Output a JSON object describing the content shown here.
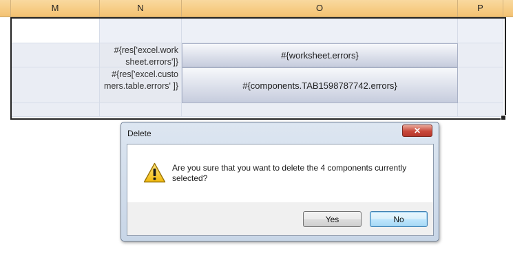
{
  "spreadsheet": {
    "columns": [
      "M",
      "N",
      "O",
      "P"
    ],
    "rows": [
      {
        "key_text": "",
        "value_text": ""
      },
      {
        "key_text": "#{res['excel.work sheet.errors']}",
        "value_text": "#{worksheet.errors}"
      },
      {
        "key_text": "#{res['excel.custo mers.table.errors' ]}",
        "value_text": "#{components.TAB1598787742.errors}"
      }
    ]
  },
  "dialog": {
    "title": "Delete",
    "close_label": "✕",
    "message": "Are you sure that you want to delete the 4 components currently selected?",
    "icon": "warning-icon",
    "buttons": {
      "yes": "Yes",
      "no": "No"
    }
  },
  "colors": {
    "header_bg": "#f4c271",
    "cell_bg": "#eaedf4",
    "close_button": "#c8473a",
    "default_button_border": "#3c7fb1"
  }
}
